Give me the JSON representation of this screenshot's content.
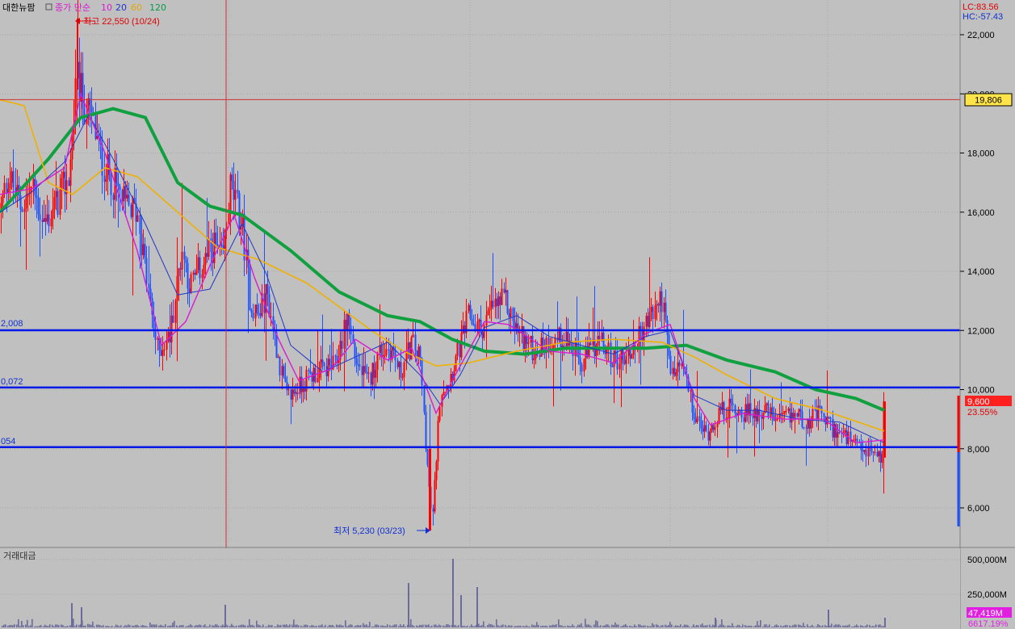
{
  "header": {
    "stock_name": "대한뉴팜",
    "ma_label": "종가 단순",
    "ma_periods": [
      {
        "label": "10",
        "color": "#d81bd1"
      },
      {
        "label": "20",
        "color": "#2236c8"
      },
      {
        "label": "60",
        "color": "#e3a700"
      },
      {
        "label": "120",
        "color": "#0a9a4a"
      }
    ],
    "lc": "LC:83.56",
    "hc": "HC:-57.43"
  },
  "annotations": {
    "high": "최고 22,550 (10/24)",
    "low": "최저 5,230 (03/23)",
    "line1": "2,008",
    "line2": "0,072",
    "line3": "054"
  },
  "price_axis": {
    "ticks": [
      "22,000",
      "20,000",
      "18,000",
      "16,000",
      "14,000",
      "12,000",
      "10,000",
      "8,000",
      "6,000"
    ],
    "crosshair_price": "19,806",
    "current_price": "9,600",
    "current_change": "23.55%"
  },
  "volume_panel": {
    "title": "거래대금",
    "ticks": [
      "500,000M",
      "250,000M"
    ],
    "current_value": "47,419M",
    "current_pct": "6617.19%"
  },
  "colors": {
    "up": "#ff0000",
    "down": "#1e50ff",
    "ma10": "#d81bd1",
    "ma20": "#2236c8",
    "ma60": "#f0b000",
    "ma120": "#10a040",
    "hline": "#0018e8",
    "volume": "#6b6b9c"
  },
  "chart_data": {
    "type": "candlestick",
    "ylim": [
      5000,
      23000
    ],
    "horizontal_lines": [
      12008,
      10072,
      8054
    ],
    "crosshair_price": 19806,
    "high_point": {
      "price": 22550,
      "date": "10/24"
    },
    "low_point": {
      "price": 5230,
      "date": "03/23"
    },
    "last_price": 9600,
    "close_path": [
      [
        0,
        16000
      ],
      [
        10,
        17300
      ],
      [
        25,
        16200
      ],
      [
        40,
        16800
      ],
      [
        55,
        15600
      ],
      [
        70,
        16300
      ],
      [
        85,
        17200
      ],
      [
        95,
        20500
      ],
      [
        105,
        19500
      ],
      [
        115,
        19000
      ],
      [
        125,
        17800
      ],
      [
        140,
        17000
      ],
      [
        155,
        16200
      ],
      [
        170,
        16000
      ],
      [
        185,
        13000
      ],
      [
        195,
        11300
      ],
      [
        210,
        11800
      ],
      [
        225,
        14800
      ],
      [
        235,
        13500
      ],
      [
        250,
        14200
      ],
      [
        265,
        14900
      ],
      [
        275,
        14300
      ],
      [
        285,
        16900
      ],
      [
        300,
        15500
      ],
      [
        310,
        12900
      ],
      [
        320,
        12500
      ],
      [
        330,
        13300
      ],
      [
        345,
        11000
      ],
      [
        355,
        9700
      ],
      [
        370,
        10100
      ],
      [
        385,
        10500
      ],
      [
        400,
        10700
      ],
      [
        415,
        10800
      ],
      [
        430,
        12500
      ],
      [
        440,
        11000
      ],
      [
        455,
        10200
      ],
      [
        470,
        11300
      ],
      [
        485,
        11400
      ],
      [
        495,
        10500
      ],
      [
        510,
        11600
      ],
      [
        520,
        11000
      ],
      [
        530,
        7000
      ],
      [
        535,
        5500
      ],
      [
        545,
        10000
      ],
      [
        555,
        10300
      ],
      [
        570,
        11500
      ],
      [
        580,
        12500
      ],
      [
        595,
        12000
      ],
      [
        610,
        12800
      ],
      [
        625,
        13000
      ],
      [
        640,
        12000
      ],
      [
        660,
        11300
      ],
      [
        680,
        11600
      ],
      [
        700,
        11800
      ],
      [
        720,
        10800
      ],
      [
        740,
        11700
      ],
      [
        760,
        11000
      ],
      [
        780,
        11200
      ],
      [
        795,
        12000
      ],
      [
        810,
        12700
      ],
      [
        820,
        13100
      ],
      [
        830,
        10500
      ],
      [
        845,
        10800
      ],
      [
        860,
        9000
      ],
      [
        875,
        8500
      ],
      [
        890,
        9200
      ],
      [
        905,
        9400
      ],
      [
        925,
        9200
      ],
      [
        945,
        9300
      ],
      [
        965,
        8900
      ],
      [
        985,
        9200
      ],
      [
        1000,
        8900
      ],
      [
        1015,
        9200
      ],
      [
        1030,
        8700
      ],
      [
        1050,
        8300
      ],
      [
        1065,
        7900
      ],
      [
        1080,
        7900
      ],
      [
        1092,
        7700
      ],
      [
        1096,
        9600
      ]
    ],
    "volume_spikes": [
      [
        88,
        30
      ],
      [
        100,
        25
      ],
      [
        278,
        28
      ],
      [
        505,
        55
      ],
      [
        560,
        85
      ],
      [
        570,
        40
      ],
      [
        590,
        50
      ],
      [
        885,
        12
      ],
      [
        1025,
        22
      ],
      [
        1095,
        12
      ]
    ],
    "ma120": [
      [
        0,
        16000
      ],
      [
        60,
        17800
      ],
      [
        100,
        19200
      ],
      [
        140,
        19500
      ],
      [
        180,
        19200
      ],
      [
        220,
        17000
      ],
      [
        260,
        16200
      ],
      [
        300,
        15900
      ],
      [
        360,
        14700
      ],
      [
        420,
        13300
      ],
      [
        480,
        12500
      ],
      [
        520,
        12300
      ],
      [
        560,
        11700
      ],
      [
        600,
        11300
      ],
      [
        650,
        11200
      ],
      [
        700,
        11400
      ],
      [
        760,
        11400
      ],
      [
        800,
        11400
      ],
      [
        850,
        11500
      ],
      [
        900,
        11000
      ],
      [
        960,
        10600
      ],
      [
        1010,
        10000
      ],
      [
        1060,
        9700
      ],
      [
        1095,
        9300
      ]
    ],
    "ma60": [
      [
        0,
        19800
      ],
      [
        30,
        19600
      ],
      [
        60,
        17000
      ],
      [
        90,
        16600
      ],
      [
        130,
        17500
      ],
      [
        170,
        17200
      ],
      [
        220,
        16000
      ],
      [
        270,
        14800
      ],
      [
        320,
        14400
      ],
      [
        380,
        13600
      ],
      [
        420,
        12800
      ],
      [
        460,
        12000
      ],
      [
        500,
        11300
      ],
      [
        540,
        10800
      ],
      [
        580,
        10900
      ],
      [
        640,
        11300
      ],
      [
        700,
        11600
      ],
      [
        760,
        11700
      ],
      [
        820,
        11600
      ],
      [
        860,
        11100
      ],
      [
        900,
        10500
      ],
      [
        960,
        9700
      ],
      [
        1020,
        9300
      ],
      [
        1095,
        8600
      ]
    ],
    "ma20": [
      [
        0,
        16000
      ],
      [
        40,
        16700
      ],
      [
        80,
        17700
      ],
      [
        110,
        19300
      ],
      [
        140,
        17800
      ],
      [
        180,
        15600
      ],
      [
        220,
        13200
      ],
      [
        260,
        13400
      ],
      [
        300,
        15600
      ],
      [
        330,
        13900
      ],
      [
        360,
        11500
      ],
      [
        400,
        10600
      ],
      [
        440,
        11100
      ],
      [
        480,
        11600
      ],
      [
        520,
        10500
      ],
      [
        545,
        9500
      ],
      [
        570,
        10500
      ],
      [
        600,
        12100
      ],
      [
        640,
        12500
      ],
      [
        680,
        11800
      ],
      [
        720,
        11500
      ],
      [
        760,
        11200
      ],
      [
        800,
        11800
      ],
      [
        830,
        12000
      ],
      [
        860,
        9800
      ],
      [
        900,
        9300
      ],
      [
        940,
        9300
      ],
      [
        990,
        9000
      ],
      [
        1040,
        8900
      ],
      [
        1095,
        8200
      ]
    ],
    "ma10": [
      [
        0,
        16600
      ],
      [
        40,
        16800
      ],
      [
        80,
        17500
      ],
      [
        100,
        20000
      ],
      [
        130,
        18000
      ],
      [
        170,
        14700
      ],
      [
        200,
        11500
      ],
      [
        230,
        12300
      ],
      [
        260,
        14200
      ],
      [
        290,
        15900
      ],
      [
        315,
        13800
      ],
      [
        345,
        11700
      ],
      [
        370,
        10300
      ],
      [
        410,
        10700
      ],
      [
        440,
        11700
      ],
      [
        480,
        11000
      ],
      [
        510,
        11400
      ],
      [
        540,
        9200
      ],
      [
        560,
        10300
      ],
      [
        600,
        12300
      ],
      [
        630,
        12200
      ],
      [
        680,
        11300
      ],
      [
        720,
        11200
      ],
      [
        760,
        10900
      ],
      [
        800,
        11900
      ],
      [
        830,
        12200
      ],
      [
        860,
        9700
      ],
      [
        880,
        8800
      ],
      [
        920,
        9200
      ],
      [
        970,
        9000
      ],
      [
        1020,
        9000
      ],
      [
        1060,
        8200
      ],
      [
        1095,
        8300
      ]
    ]
  }
}
